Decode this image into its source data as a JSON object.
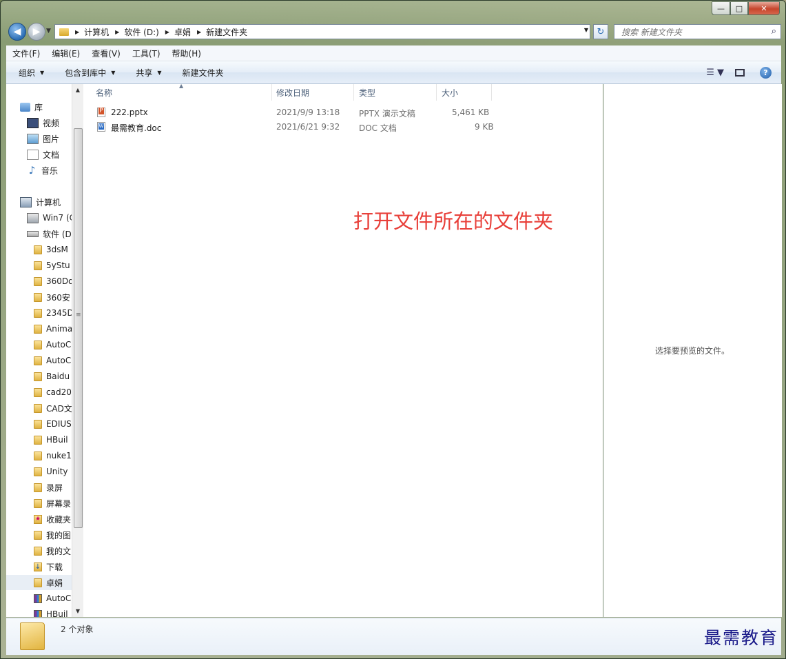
{
  "window": {
    "controls": {
      "minimize": "—",
      "maximize": "□",
      "close": "✕"
    }
  },
  "nav": {
    "back_icon": "back-arrow-icon",
    "forward_icon": "forward-arrow-icon",
    "breadcrumb": [
      "计算机",
      "软件 (D:)",
      "卓娟",
      "新建文件夹"
    ],
    "search_placeholder": "搜索 新建文件夹"
  },
  "menu": [
    "文件(F)",
    "编辑(E)",
    "查看(V)",
    "工具(T)",
    "帮助(H)"
  ],
  "commands": [
    "组织",
    "包含到库中",
    "共享",
    "新建文件夹"
  ],
  "sidebar": {
    "library": "库",
    "library_items": [
      "视频",
      "图片",
      "文档",
      "音乐"
    ],
    "computer": "计算机",
    "drives": [
      "Win7 (C",
      "软件 (D:"
    ],
    "folders": [
      {
        "label": "3dsM",
        "icon": "folder"
      },
      {
        "label": "5yStu",
        "icon": "folder"
      },
      {
        "label": "360Do",
        "icon": "folder"
      },
      {
        "label": "360安",
        "icon": "folder"
      },
      {
        "label": "2345D",
        "icon": "folder"
      },
      {
        "label": "Anima",
        "icon": "folder"
      },
      {
        "label": "AutoC",
        "icon": "folder"
      },
      {
        "label": "AutoC",
        "icon": "folder"
      },
      {
        "label": "Baidu",
        "icon": "folder"
      },
      {
        "label": "cad20",
        "icon": "folder"
      },
      {
        "label": "CAD文",
        "icon": "folder"
      },
      {
        "label": "EDIUS",
        "icon": "folder"
      },
      {
        "label": "HBuil",
        "icon": "folder"
      },
      {
        "label": "nuke1",
        "icon": "folder"
      },
      {
        "label": "Unity",
        "icon": "folder"
      },
      {
        "label": "录屏",
        "icon": "folder"
      },
      {
        "label": "屏幕录",
        "icon": "folder"
      },
      {
        "label": "收藏夹",
        "icon": "favorites"
      },
      {
        "label": "我的图",
        "icon": "folder-doc"
      },
      {
        "label": "我的文",
        "icon": "folder-doc"
      },
      {
        "label": "下载",
        "icon": "download"
      },
      {
        "label": "卓娟",
        "icon": "folder",
        "selected": true
      },
      {
        "label": "AutoC",
        "icon": "rar"
      },
      {
        "label": "HBuil",
        "icon": "rar"
      }
    ]
  },
  "columns": [
    "名称",
    "修改日期",
    "类型",
    "大小"
  ],
  "files": [
    {
      "name": "222.pptx",
      "date": "2021/9/9 13:18",
      "type": "PPTX 演示文稿",
      "size": "5,461 KB",
      "icon": "pptx"
    },
    {
      "name": "最需教育.doc",
      "date": "2021/6/21 9:32",
      "type": "DOC 文档",
      "size": "9 KB",
      "icon": "doc"
    }
  ],
  "annotation": "打开文件所在的文件夹",
  "preview_text": "选择要预览的文件。",
  "status": "2 个对象",
  "watermark": "最需教育"
}
